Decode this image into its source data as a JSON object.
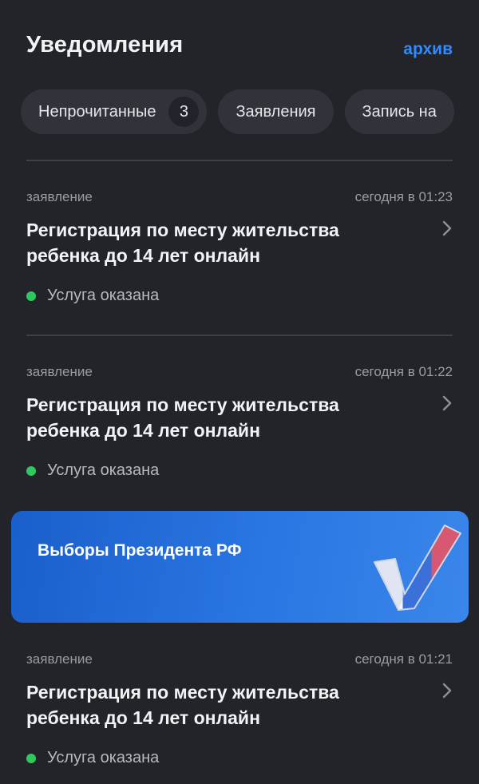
{
  "header": {
    "title": "Уведомления",
    "archive_link": "архив"
  },
  "filters": [
    {
      "label": "Непрочитанные",
      "count": "3"
    },
    {
      "label": "Заявления"
    },
    {
      "label": "Запись на"
    }
  ],
  "notifications": [
    {
      "type": "заявление",
      "time": "сегодня в 01:23",
      "title": "Регистрация по месту жительства ребенка до 14 лет онлайн",
      "status": "Услуга оказана"
    },
    {
      "type": "заявление",
      "time": "сегодня в 01:22",
      "title": "Регистрация по месту жительства ребенка до 14 лет онлайн",
      "status": "Услуга оказана"
    },
    {
      "type": "заявление",
      "time": "сегодня в 01:21",
      "title": "Регистрация по месту жительства ребенка до 14 лет онлайн",
      "status": "Услуга оказана"
    }
  ],
  "banner": {
    "title": "Выборы Президента РФ",
    "icon": "checkmark-flag-icon"
  },
  "colors": {
    "background": "#232429",
    "accent": "#2f8bff",
    "status_ok": "#2ec95c",
    "banner": "#2b78e4"
  }
}
